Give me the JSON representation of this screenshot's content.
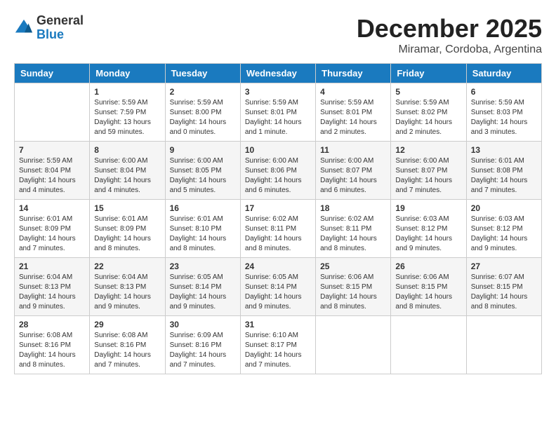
{
  "logo": {
    "general": "General",
    "blue": "Blue"
  },
  "title": "December 2025",
  "location": "Miramar, Cordoba, Argentina",
  "weekdays": [
    "Sunday",
    "Monday",
    "Tuesday",
    "Wednesday",
    "Thursday",
    "Friday",
    "Saturday"
  ],
  "weeks": [
    [
      {
        "day": "",
        "sunrise": "",
        "sunset": "",
        "daylight": ""
      },
      {
        "day": "1",
        "sunrise": "Sunrise: 5:59 AM",
        "sunset": "Sunset: 7:59 PM",
        "daylight": "Daylight: 13 hours and 59 minutes."
      },
      {
        "day": "2",
        "sunrise": "Sunrise: 5:59 AM",
        "sunset": "Sunset: 8:00 PM",
        "daylight": "Daylight: 14 hours and 0 minutes."
      },
      {
        "day": "3",
        "sunrise": "Sunrise: 5:59 AM",
        "sunset": "Sunset: 8:01 PM",
        "daylight": "Daylight: 14 hours and 1 minute."
      },
      {
        "day": "4",
        "sunrise": "Sunrise: 5:59 AM",
        "sunset": "Sunset: 8:01 PM",
        "daylight": "Daylight: 14 hours and 2 minutes."
      },
      {
        "day": "5",
        "sunrise": "Sunrise: 5:59 AM",
        "sunset": "Sunset: 8:02 PM",
        "daylight": "Daylight: 14 hours and 2 minutes."
      },
      {
        "day": "6",
        "sunrise": "Sunrise: 5:59 AM",
        "sunset": "Sunset: 8:03 PM",
        "daylight": "Daylight: 14 hours and 3 minutes."
      }
    ],
    [
      {
        "day": "7",
        "sunrise": "Sunrise: 5:59 AM",
        "sunset": "Sunset: 8:04 PM",
        "daylight": "Daylight: 14 hours and 4 minutes."
      },
      {
        "day": "8",
        "sunrise": "Sunrise: 6:00 AM",
        "sunset": "Sunset: 8:04 PM",
        "daylight": "Daylight: 14 hours and 4 minutes."
      },
      {
        "day": "9",
        "sunrise": "Sunrise: 6:00 AM",
        "sunset": "Sunset: 8:05 PM",
        "daylight": "Daylight: 14 hours and 5 minutes."
      },
      {
        "day": "10",
        "sunrise": "Sunrise: 6:00 AM",
        "sunset": "Sunset: 8:06 PM",
        "daylight": "Daylight: 14 hours and 6 minutes."
      },
      {
        "day": "11",
        "sunrise": "Sunrise: 6:00 AM",
        "sunset": "Sunset: 8:07 PM",
        "daylight": "Daylight: 14 hours and 6 minutes."
      },
      {
        "day": "12",
        "sunrise": "Sunrise: 6:00 AM",
        "sunset": "Sunset: 8:07 PM",
        "daylight": "Daylight: 14 hours and 7 minutes."
      },
      {
        "day": "13",
        "sunrise": "Sunrise: 6:01 AM",
        "sunset": "Sunset: 8:08 PM",
        "daylight": "Daylight: 14 hours and 7 minutes."
      }
    ],
    [
      {
        "day": "14",
        "sunrise": "Sunrise: 6:01 AM",
        "sunset": "Sunset: 8:09 PM",
        "daylight": "Daylight: 14 hours and 7 minutes."
      },
      {
        "day": "15",
        "sunrise": "Sunrise: 6:01 AM",
        "sunset": "Sunset: 8:09 PM",
        "daylight": "Daylight: 14 hours and 8 minutes."
      },
      {
        "day": "16",
        "sunrise": "Sunrise: 6:01 AM",
        "sunset": "Sunset: 8:10 PM",
        "daylight": "Daylight: 14 hours and 8 minutes."
      },
      {
        "day": "17",
        "sunrise": "Sunrise: 6:02 AM",
        "sunset": "Sunset: 8:11 PM",
        "daylight": "Daylight: 14 hours and 8 minutes."
      },
      {
        "day": "18",
        "sunrise": "Sunrise: 6:02 AM",
        "sunset": "Sunset: 8:11 PM",
        "daylight": "Daylight: 14 hours and 8 minutes."
      },
      {
        "day": "19",
        "sunrise": "Sunrise: 6:03 AM",
        "sunset": "Sunset: 8:12 PM",
        "daylight": "Daylight: 14 hours and 9 minutes."
      },
      {
        "day": "20",
        "sunrise": "Sunrise: 6:03 AM",
        "sunset": "Sunset: 8:12 PM",
        "daylight": "Daylight: 14 hours and 9 minutes."
      }
    ],
    [
      {
        "day": "21",
        "sunrise": "Sunrise: 6:04 AM",
        "sunset": "Sunset: 8:13 PM",
        "daylight": "Daylight: 14 hours and 9 minutes."
      },
      {
        "day": "22",
        "sunrise": "Sunrise: 6:04 AM",
        "sunset": "Sunset: 8:13 PM",
        "daylight": "Daylight: 14 hours and 9 minutes."
      },
      {
        "day": "23",
        "sunrise": "Sunrise: 6:05 AM",
        "sunset": "Sunset: 8:14 PM",
        "daylight": "Daylight: 14 hours and 9 minutes."
      },
      {
        "day": "24",
        "sunrise": "Sunrise: 6:05 AM",
        "sunset": "Sunset: 8:14 PM",
        "daylight": "Daylight: 14 hours and 9 minutes."
      },
      {
        "day": "25",
        "sunrise": "Sunrise: 6:06 AM",
        "sunset": "Sunset: 8:15 PM",
        "daylight": "Daylight: 14 hours and 8 minutes."
      },
      {
        "day": "26",
        "sunrise": "Sunrise: 6:06 AM",
        "sunset": "Sunset: 8:15 PM",
        "daylight": "Daylight: 14 hours and 8 minutes."
      },
      {
        "day": "27",
        "sunrise": "Sunrise: 6:07 AM",
        "sunset": "Sunset: 8:15 PM",
        "daylight": "Daylight: 14 hours and 8 minutes."
      }
    ],
    [
      {
        "day": "28",
        "sunrise": "Sunrise: 6:08 AM",
        "sunset": "Sunset: 8:16 PM",
        "daylight": "Daylight: 14 hours and 8 minutes."
      },
      {
        "day": "29",
        "sunrise": "Sunrise: 6:08 AM",
        "sunset": "Sunset: 8:16 PM",
        "daylight": "Daylight: 14 hours and 7 minutes."
      },
      {
        "day": "30",
        "sunrise": "Sunrise: 6:09 AM",
        "sunset": "Sunset: 8:16 PM",
        "daylight": "Daylight: 14 hours and 7 minutes."
      },
      {
        "day": "31",
        "sunrise": "Sunrise: 6:10 AM",
        "sunset": "Sunset: 8:17 PM",
        "daylight": "Daylight: 14 hours and 7 minutes."
      },
      {
        "day": "",
        "sunrise": "",
        "sunset": "",
        "daylight": ""
      },
      {
        "day": "",
        "sunrise": "",
        "sunset": "",
        "daylight": ""
      },
      {
        "day": "",
        "sunrise": "",
        "sunset": "",
        "daylight": ""
      }
    ]
  ]
}
